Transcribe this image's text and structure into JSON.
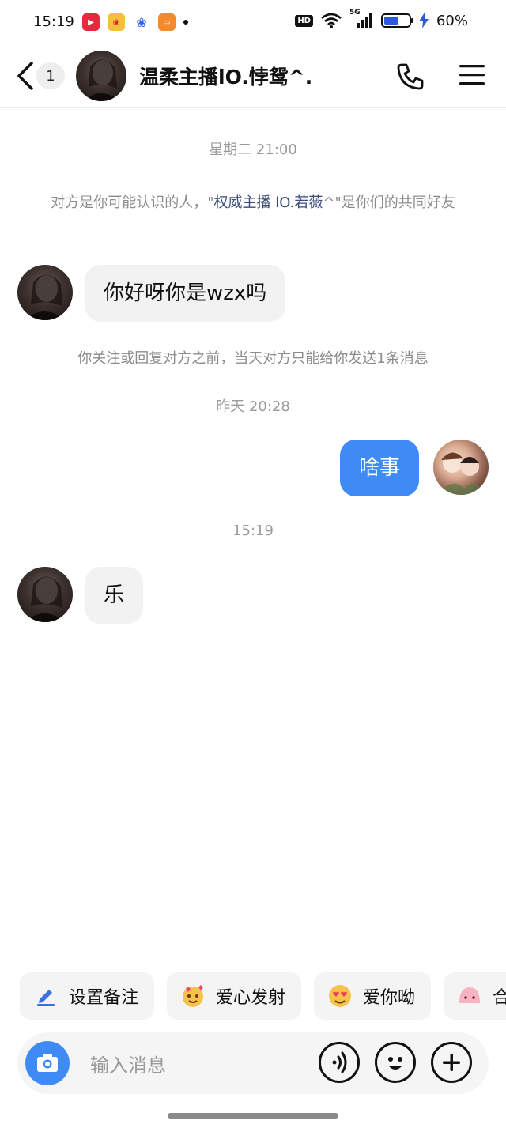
{
  "status_bar": {
    "time": "15:19",
    "hd": "HD",
    "network": "5G",
    "battery_pct": "60%",
    "battery_level": 0.6,
    "app_icons": [
      "video-app-icon",
      "weibo-icon",
      "baidu-icon",
      "wallet-icon"
    ]
  },
  "header": {
    "unread_count": "1",
    "title": "温柔主播lO.悖鸳^."
  },
  "messages": [
    {
      "kind": "timestamp",
      "text": "星期二 21:00"
    },
    {
      "kind": "system",
      "pre": "对方是你可能认识的人，\"",
      "highlight": "权威主播 lO.若薇",
      "post": "^\"是你们的共同好友"
    },
    {
      "kind": "incoming",
      "text": "你好呀你是wzx吗"
    },
    {
      "kind": "system_plain",
      "text": "你关注或回复对方之前，当天对方只能给你发送1条消息"
    },
    {
      "kind": "timestamp",
      "text": "昨天 20:28"
    },
    {
      "kind": "outgoing",
      "text": "啥事"
    },
    {
      "kind": "timestamp",
      "text": "15:19"
    },
    {
      "kind": "incoming",
      "text": "乐"
    }
  ],
  "quick_actions": [
    {
      "label": "设置备注",
      "icon": "edit-icon"
    },
    {
      "label": "爱心发射",
      "icon": "heart-burst-emoji-icon"
    },
    {
      "label": "爱你呦",
      "icon": "heart-eyes-emoji-icon"
    },
    {
      "label": "合",
      "icon": "pink-blob-icon"
    }
  ],
  "input": {
    "placeholder": "输入消息"
  },
  "colors": {
    "accent": "#3e8bf6",
    "bubble_in": "#f2f2f3",
    "system_text": "#8c8c8c",
    "highlight_text": "#3a4a78"
  }
}
